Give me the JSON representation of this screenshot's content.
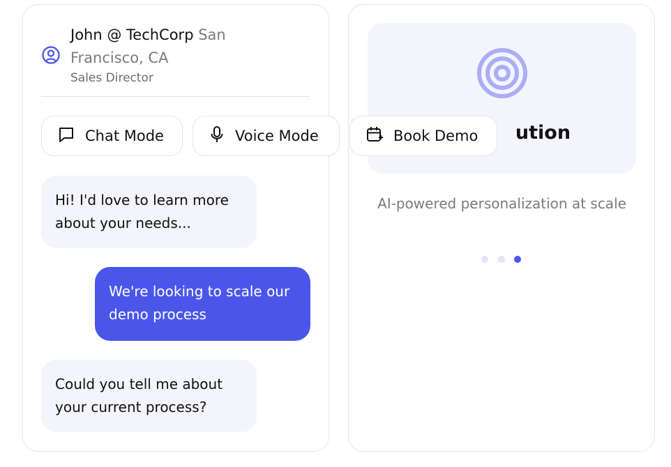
{
  "profile": {
    "name": "John @ TechCorp",
    "location_part1": "San",
    "location_part2": "Francisco, CA",
    "role": "Sales Director"
  },
  "modes": {
    "chat": "Chat Mode",
    "voice": "Voice Mode",
    "book": "Book Demo"
  },
  "messages": [
    {
      "from": "bot",
      "text": "Hi! I'd love to learn more about your needs..."
    },
    {
      "from": "user",
      "text": "We're looking to scale our demo process"
    },
    {
      "from": "bot",
      "text": "Could you tell me about your current process?"
    }
  ],
  "feature": {
    "title_visible": "ution",
    "description": "AI-powered personalization at scale"
  },
  "carousel": {
    "dot_count": 3,
    "active_index": 2
  },
  "colors": {
    "accent": "#4a56ea",
    "icon_ring": "#a9aef5",
    "bubble_bot": "#f4f4fb",
    "dot_inactive": "#e3e4f8"
  },
  "icons": {
    "profile": "user-circle-icon",
    "chat": "chat-bubble-icon",
    "voice": "microphone-icon",
    "book": "calendar-plus-icon",
    "feature": "target-icon"
  }
}
